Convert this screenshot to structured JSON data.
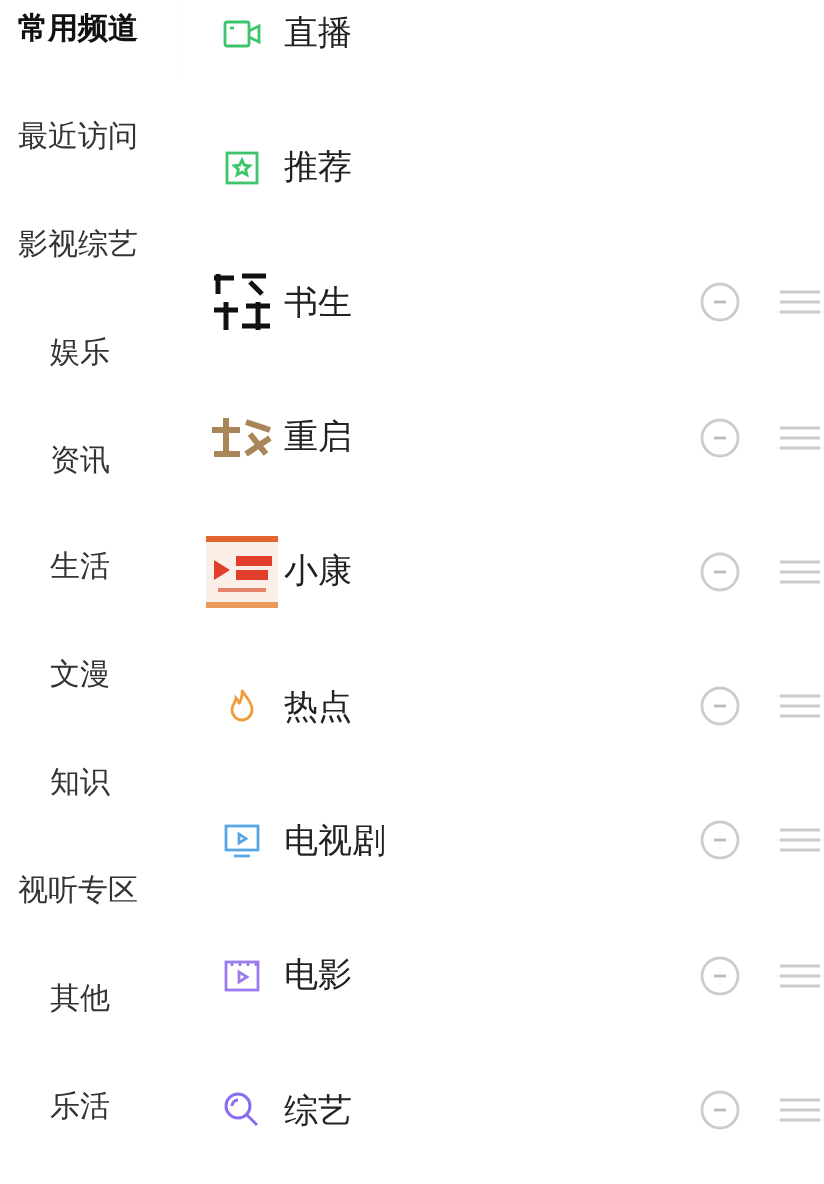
{
  "sidebar": {
    "items": [
      {
        "label": "常用频道",
        "selected": true
      },
      {
        "label": "最近访问",
        "selected": false
      },
      {
        "label": "影视综艺",
        "selected": false,
        "children": [
          {
            "label": "娱乐",
            "selected": false
          },
          {
            "label": "资讯",
            "selected": false
          },
          {
            "label": "生活",
            "selected": false
          },
          {
            "label": "文漫",
            "selected": false
          },
          {
            "label": "知识",
            "selected": false
          }
        ]
      },
      {
        "label": "视听专区",
        "selected": false,
        "children": [
          {
            "label": "其他",
            "selected": false
          },
          {
            "label": "乐活",
            "selected": false
          }
        ]
      }
    ]
  },
  "channels": [
    {
      "label": "直播",
      "kind": "fixed"
    },
    {
      "label": "推荐",
      "kind": "fixed"
    },
    {
      "label": "书生",
      "kind": "removable"
    },
    {
      "label": "重启",
      "kind": "removable"
    },
    {
      "label": "小康",
      "kind": "removable"
    },
    {
      "label": "热点",
      "kind": "removable"
    },
    {
      "label": "电视剧",
      "kind": "removable"
    },
    {
      "label": "电影",
      "kind": "removable"
    },
    {
      "label": "综艺",
      "kind": "removable"
    }
  ]
}
